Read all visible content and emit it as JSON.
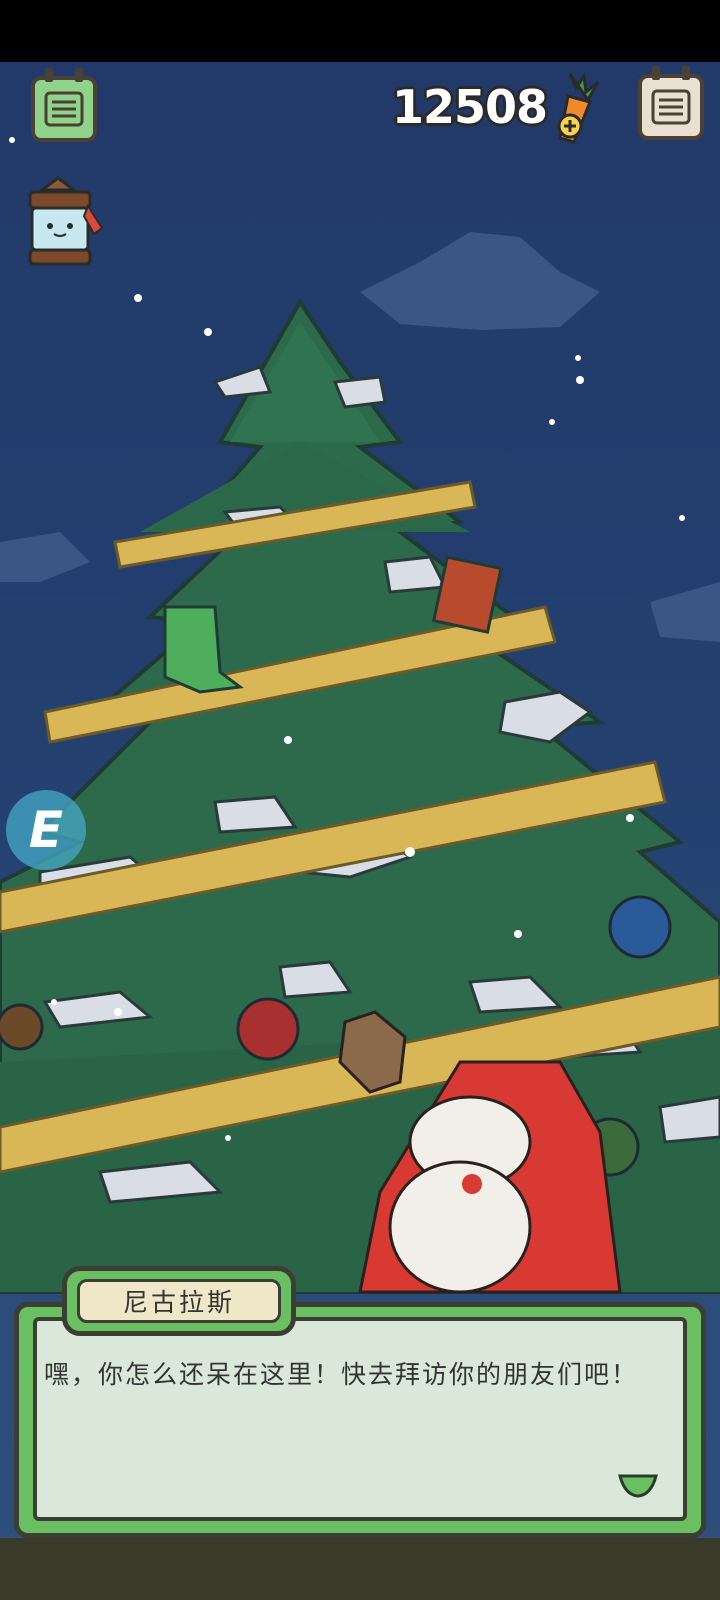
{
  "hud": {
    "carrot_count": "12508",
    "menu_left_icon": "menu-icon",
    "menu_right_icon": "menu-icon",
    "carrot_icon": "carrot-plus-icon"
  },
  "dialog": {
    "speaker": "尼古拉斯",
    "text": "嘿，你怎么还呆在这里！快去拜访你的朋友们吧！"
  },
  "colors": {
    "sky": "#23406f",
    "tree": "#2f6b4c",
    "garland": "#d9b656",
    "dialog_green": "#6abf63"
  }
}
